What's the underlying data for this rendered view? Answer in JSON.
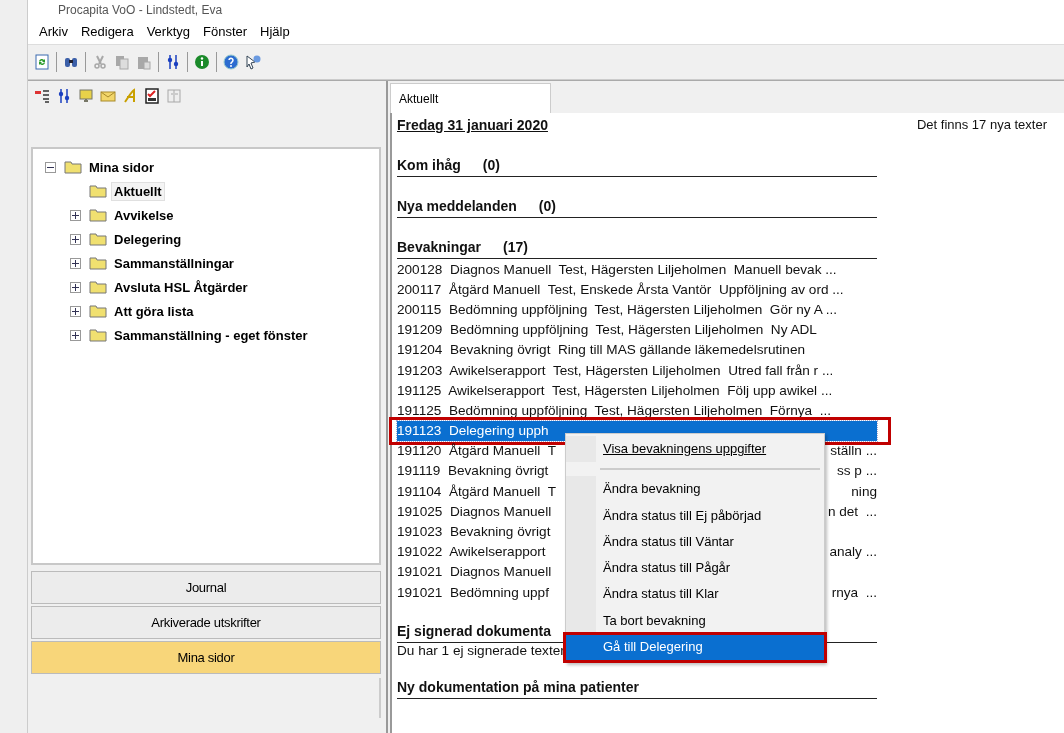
{
  "window": {
    "title": "Procapita VoO - Lindstedt, Eva"
  },
  "menu_bar": [
    "Arkiv",
    "Redigera",
    "Verktyg",
    "Fönster",
    "Hjälp"
  ],
  "toolbar": [
    {
      "kind": "refresh",
      "disabled": false
    },
    {
      "kind": "find",
      "disabled": false
    },
    {
      "kind": "cut",
      "disabled": true
    },
    {
      "kind": "copy",
      "disabled": true
    },
    {
      "kind": "paste",
      "disabled": true
    },
    {
      "kind": "sliders",
      "disabled": false
    },
    {
      "kind": "info",
      "disabled": false
    },
    {
      "kind": "help",
      "disabled": false
    },
    {
      "kind": "pointer-help",
      "disabled": false
    }
  ],
  "side_toolbar": [
    {
      "kind": "list",
      "disabled": false
    },
    {
      "kind": "sliders",
      "disabled": false
    },
    {
      "kind": "monitor",
      "disabled": false
    },
    {
      "kind": "envelope",
      "disabled": false
    },
    {
      "kind": "font",
      "disabled": false
    },
    {
      "kind": "checklist",
      "disabled": false
    },
    {
      "kind": "book",
      "disabled": true
    }
  ],
  "tree": [
    {
      "label": "Mina sidor",
      "expanded": true,
      "selected": false,
      "children": [
        {
          "label": "Aktuellt",
          "selected": true
        },
        {
          "label": "Avvikelse",
          "expanded": false,
          "selected": false
        },
        {
          "label": "Delegering",
          "expanded": false,
          "selected": false
        },
        {
          "label": "Sammanställningar",
          "expanded": false,
          "selected": false
        },
        {
          "label": "Avsluta HSL Åtgärder",
          "expanded": false,
          "selected": false
        },
        {
          "label": "Att göra lista",
          "expanded": false,
          "selected": false
        },
        {
          "label": "Sammanställning - eget fönster",
          "expanded": false,
          "selected": false
        }
      ]
    }
  ],
  "nav_buttons": [
    {
      "label": "Journal",
      "selected": false
    },
    {
      "label": "Arkiverade utskrifter",
      "selected": false
    },
    {
      "label": "Mina sidor",
      "selected": true
    }
  ],
  "tabs": [
    {
      "label": "Aktuellt",
      "selected": true
    }
  ],
  "content": {
    "date": "Fredag 31 januari 2020",
    "notice": "Det finns 17 nya texter",
    "sections": [
      {
        "kind": "header",
        "title": "Kom ihåg",
        "count": "(0)"
      },
      {
        "kind": "header",
        "title": "Nya meddelanden",
        "count": "(0)"
      },
      {
        "kind": "list",
        "title": "Bevakningar",
        "count": "(17)",
        "rows": [
          {
            "text": "200128  Diagnos Manuell  Test, Hägersten Liljeholmen  Manuell bevak ...",
            "selected": false
          },
          {
            "text": "200117  Åtgärd Manuell  Test, Enskede Årsta Vantör  Uppföljning av ord ...",
            "selected": false
          },
          {
            "text": "200115  Bedömning uppföljning  Test, Hägersten Liljeholmen  Gör ny A ...",
            "selected": false
          },
          {
            "text": "191209  Bedömning uppföljning  Test, Hägersten Liljeholmen  Ny ADL",
            "selected": false
          },
          {
            "text": "191204  Bevakning övrigt  Ring till MAS gällande läkemedelsrutinen",
            "selected": false
          },
          {
            "text": "191203  Awikelserapport  Test, Hägersten Liljeholmen  Utred fall från r ...",
            "selected": false
          },
          {
            "text": "191125  Awikelserapport  Test, Hägersten Liljeholmen  Följ upp awikel ...",
            "selected": false
          },
          {
            "text": "191125  Bedömning uppföljning  Test, Hägersten Liljeholmen  Förnya  ...",
            "selected": false
          },
          {
            "text": "191123  Delegering upph",
            "selected": true
          },
          {
            "text": "191120  Åtgärd Manuell  T",
            "tail": "ställn ...",
            "selected": false
          },
          {
            "text": "191119  Bevakning övrigt",
            "tail": "ss p ...",
            "selected": false
          },
          {
            "text": "191104  Åtgärd Manuell  T",
            "tail": "ning",
            "selected": false
          },
          {
            "text": "191025  Diagnos Manuell",
            "tail": "n det  ...",
            "selected": false
          },
          {
            "text": "191023  Bevakning övrigt",
            "selected": false
          },
          {
            "text": "191022  Awikelserapport",
            "tail": "analy ...",
            "selected": false
          },
          {
            "text": "191021  Diagnos Manuell",
            "selected": false
          },
          {
            "text": "191021  Bedömning uppf",
            "tail": "rnya  ...",
            "selected": false
          }
        ]
      },
      {
        "kind": "message",
        "title": "Ej signerad dokumenta",
        "text": "Du har 1 ej signerade texter"
      },
      {
        "kind": "header",
        "title": "Ny dokumentation på mina patienter"
      }
    ]
  },
  "context_menu": [
    {
      "label": "Visa bevakningens uppgifter",
      "selected": false
    },
    {
      "kind": "separator"
    },
    {
      "label": "Ändra bevakning",
      "selected": false
    },
    {
      "label": "Ändra status till Ej påbörjad",
      "selected": false
    },
    {
      "label": "Ändra status till Väntar",
      "selected": false
    },
    {
      "label": "Ändra status till Pågår",
      "selected": false
    },
    {
      "label": "Ändra status till Klar",
      "selected": false
    },
    {
      "label": "Ta bort bevakning",
      "selected": false
    },
    {
      "label": "Gå till Delegering",
      "selected": true
    }
  ]
}
